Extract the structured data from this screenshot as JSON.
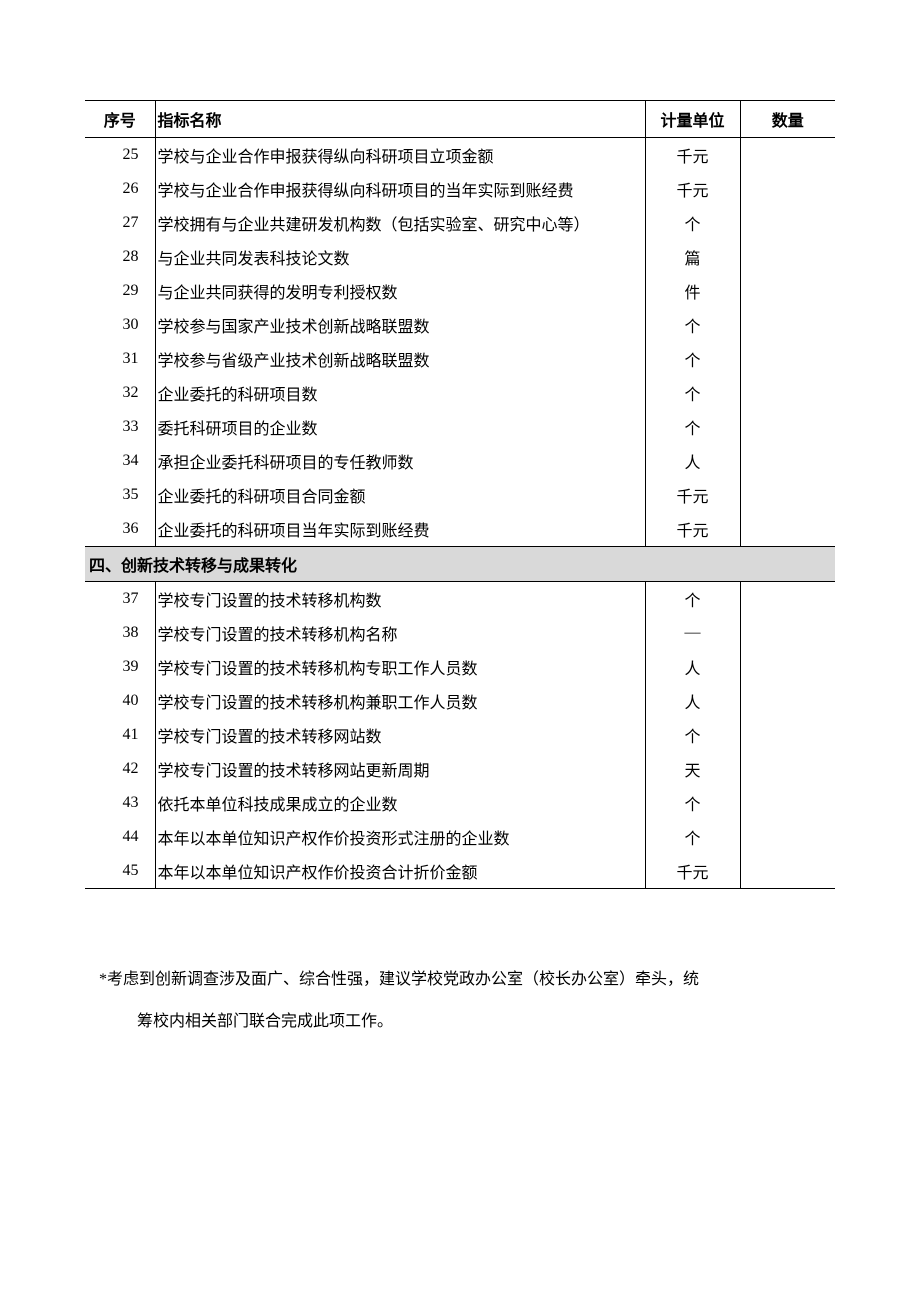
{
  "headers": {
    "num": "序号",
    "name": "指标名称",
    "unit": "计量单位",
    "qty": "数量"
  },
  "rows": [
    {
      "num": "25",
      "name": "学校与企业合作申报获得纵向科研项目立项金额",
      "unit": "千元",
      "qty": ""
    },
    {
      "num": "26",
      "name": "学校与企业合作申报获得纵向科研项目的当年实际到账经费",
      "unit": "千元",
      "qty": ""
    },
    {
      "num": "27",
      "name": "学校拥有与企业共建研发机构数（包括实验室、研究中心等）",
      "unit": "个",
      "qty": ""
    },
    {
      "num": "28",
      "name": "与企业共同发表科技论文数",
      "unit": "篇",
      "qty": ""
    },
    {
      "num": "29",
      "name": "与企业共同获得的发明专利授权数",
      "unit": "件",
      "qty": ""
    },
    {
      "num": "30",
      "name": "学校参与国家产业技术创新战略联盟数",
      "unit": "个",
      "qty": ""
    },
    {
      "num": "31",
      "name": "学校参与省级产业技术创新战略联盟数",
      "unit": "个",
      "qty": ""
    },
    {
      "num": "32",
      "name": "企业委托的科研项目数",
      "unit": "个",
      "qty": ""
    },
    {
      "num": "33",
      "name": "委托科研项目的企业数",
      "unit": "个",
      "qty": ""
    },
    {
      "num": "34",
      "name": "承担企业委托科研项目的专任教师数",
      "unit": "人",
      "qty": ""
    },
    {
      "num": "35",
      "name": "企业委托的科研项目合同金额",
      "unit": "千元",
      "qty": ""
    },
    {
      "num": "36",
      "name": "企业委托的科研项目当年实际到账经费",
      "unit": "千元",
      "qty": ""
    }
  ],
  "section": {
    "title": "四、创新技术转移与成果转化"
  },
  "rows2": [
    {
      "num": "37",
      "name": "学校专门设置的技术转移机构数",
      "unit": "个",
      "qty": ""
    },
    {
      "num": "38",
      "name": "学校专门设置的技术转移机构名称",
      "unit": "—",
      "qty": ""
    },
    {
      "num": "39",
      "name": "学校专门设置的技术转移机构专职工作人员数",
      "unit": "人",
      "qty": ""
    },
    {
      "num": "40",
      "name": "学校专门设置的技术转移机构兼职工作人员数",
      "unit": "人",
      "qty": ""
    },
    {
      "num": "41",
      "name": "学校专门设置的技术转移网站数",
      "unit": "个",
      "qty": ""
    },
    {
      "num": "42",
      "name": "学校专门设置的技术转移网站更新周期",
      "unit": "天",
      "qty": ""
    },
    {
      "num": "43",
      "name": "依托本单位科技成果成立的企业数",
      "unit": "个",
      "qty": ""
    },
    {
      "num": "44",
      "name": "本年以本单位知识产权作价投资形式注册的企业数",
      "unit": "个",
      "qty": ""
    },
    {
      "num": "45",
      "name": "本年以本单位知识产权作价投资合计折价金额",
      "unit": "千元",
      "qty": ""
    }
  ],
  "footnote": {
    "line1": "*考虑到创新调查涉及面广、综合性强，建议学校党政办公室（校长办公室）牵头，统",
    "line2": "筹校内相关部门联合完成此项工作。"
  }
}
